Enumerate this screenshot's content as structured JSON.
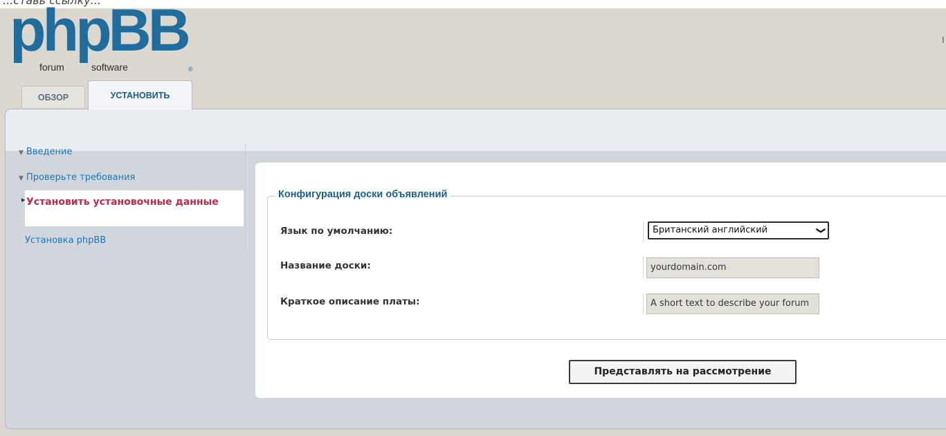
{
  "top_strip_text": "...ставь ссылку...",
  "logo": {
    "word": "phpBB",
    "sub1": "forum",
    "sub2": "software",
    "reg": "®"
  },
  "right_mark": "I",
  "tabs": [
    {
      "label": "ОБЗОР",
      "active": false
    },
    {
      "label": "УСТАНОВИТЬ",
      "active": true
    }
  ],
  "sidebar": {
    "items": [
      {
        "label": "Введение",
        "state": "done"
      },
      {
        "label": "Проверьте требования",
        "state": "done"
      },
      {
        "label": "Установить установочные данные",
        "state": "active"
      },
      {
        "label": "Установка phpBB",
        "state": "pending"
      }
    ]
  },
  "form": {
    "legend": "Конфигурация доски объявлений",
    "fields": [
      {
        "label": "Язык по умолчанию:",
        "type": "select",
        "value": "Британский английский"
      },
      {
        "label": "Название доски:",
        "type": "text",
        "value": "yourdomain.com"
      },
      {
        "label": "Краткое описание платы:",
        "type": "text",
        "value": "A short text to describe your forum"
      }
    ],
    "submit_label": "Представлять на рассмотрение"
  },
  "colors": {
    "accent": "#1f78b5",
    "active_menu": "#c0294a",
    "logo": "#1f6d9c",
    "page_background": "#dcd8d0"
  }
}
